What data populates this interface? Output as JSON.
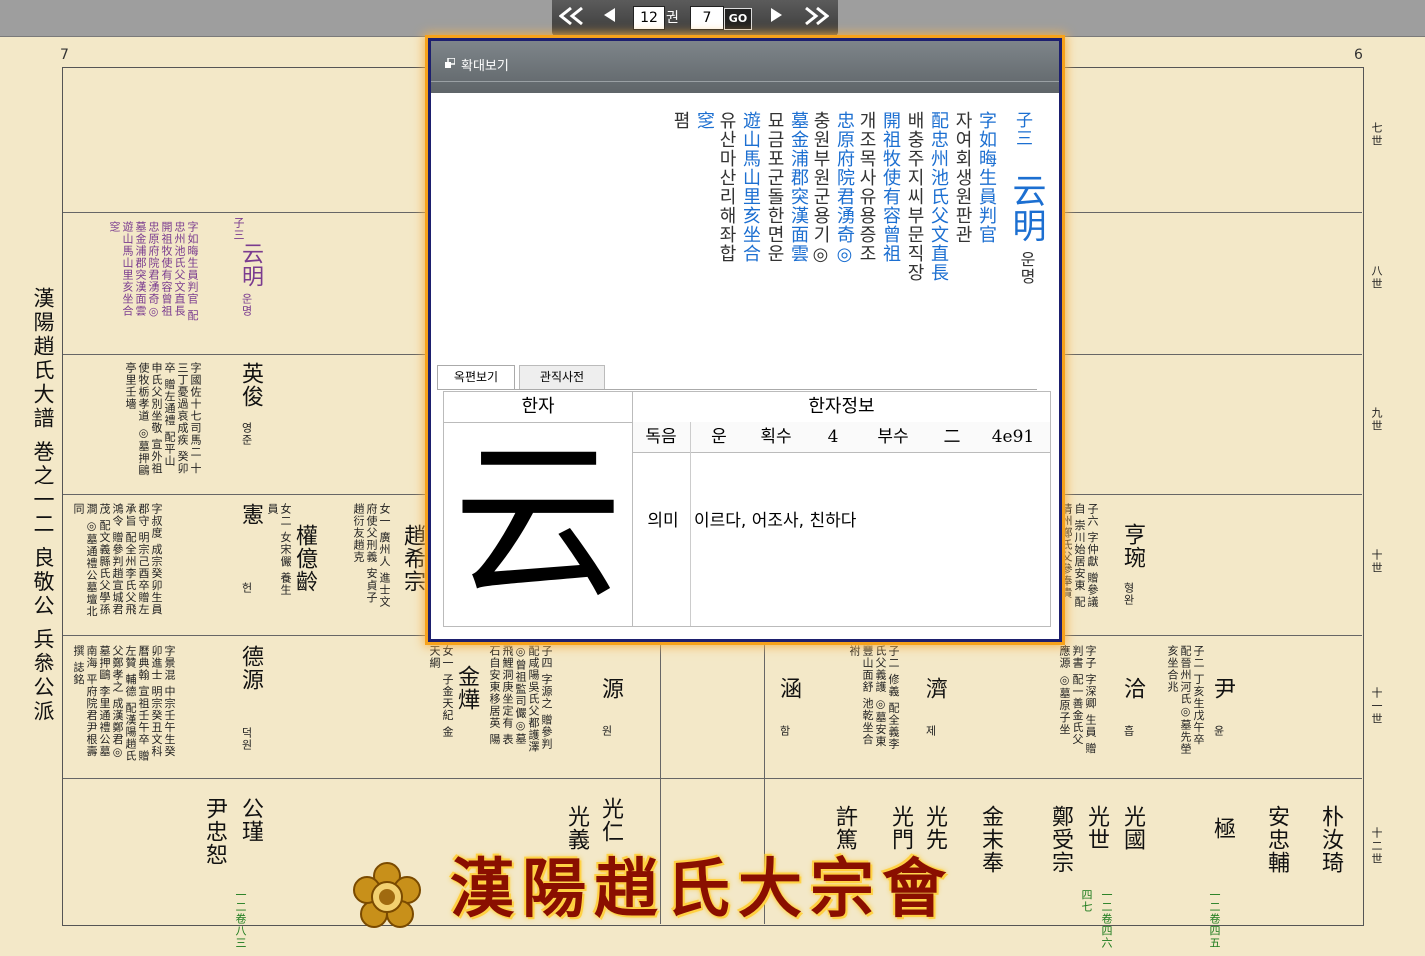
{
  "toolbar": {
    "first_icon": "double-left-arrow-icon",
    "prev_icon": "left-triangle-icon",
    "volume_value": "12",
    "volume_label": "권",
    "page_value": "7",
    "go_label": "GO",
    "next_icon": "right-triangle-icon",
    "last_icon": "double-right-arrow-icon"
  },
  "book": {
    "left_page_number": "7",
    "right_page_number": "6",
    "title": "漢陽趙氏大譜 巻之一二 良敬公 兵叅公派",
    "generations": [
      "七世",
      "八世",
      "九世",
      "十世",
      "十一世",
      "十二世"
    ]
  },
  "entries": {
    "yunmyeong_name": "云明",
    "yunmyeong_reading": "운명",
    "yunmyeong_rank": "子三",
    "yunmyeong_note": "字如晦生員判官 配忠州池氏父文直長 開祖牧使有容曾祖 忠原府院君湧奇◎ 墓金浦郡突漢面雲 遊山馬山里亥坐合 窆",
    "yeongjun_name": "英俊",
    "yeongjun_reading": "영준",
    "yeongjun_note": "字國佐十七司馬二 十三丁憂過哀成疾 癸卯卒 贈左通禮 配平山申氏父別坐敬 宣外祖使牧栃孝道 ◎墓押鷗亭里壬墻",
    "heon_name": "憲",
    "heon_reading": "헌",
    "heon_note": "字叔度 成宗癸卯生員郡守 明宗己酉卒贈左承旨 配全州李氏父飛鴻令 贈參判趙宣城君茂 配文義縣氏父學孫澗 ◎墓通禮公墓壇北 同",
    "gwon_name": "權億齡",
    "gwon_note": "女二 女宋儼 養生員",
    "jo_name": "趙希宗",
    "jo_note": "女一 廣州人 進士文府使父刑義 安貞子趙衍友趙克",
    "deokwon_name": "德源",
    "deokwon_reading": "덕원",
    "deokwon_note": "字景混 中宗壬午生癸卯進士 明宗癸丑文科曆典翰 宣祖壬午卒 贈左贊 輔德 配漢陽趙氏父鄭孝之 成漢鄭君◎墓押鷗 李里通禮公墓南海 平府院君尹根壽撰 誌銘",
    "kim_name": "金燁",
    "kim_note": "女一 子金天紀 金天綱",
    "won_name": "源",
    "won_reading": "원",
    "won_note": "子四 字源之 贈參判 配咸陽吳氏父都護澤 ◎曾祖監司儼◎墓 飛鯉洞庚坐定有 表石自安東移居英 陽",
    "ham_name": "涵",
    "ham_reading": "함",
    "je_name": "濟",
    "je_reading": "제",
    "je_note": "子二 修義 配全義李氏父義護 ◎墓安東豐山面舒 池乾坐合祔",
    "hak_name": "洽",
    "hak_reading": "흡",
    "hak_note": "字子 字深卿 生員 贈判書 配一善金氏父應源 ◎墓原子坐",
    "yun_name": "尹",
    "yun_reading": "윤",
    "yun_note": "子二 丁亥生戊午卒 配晉州河氏◎墓先塋 亥坐合兆",
    "hyeongwan_name": "亨琬",
    "hyeongwan_reading": "형완",
    "hyeongwan_note": "子六 字仲獻 贈參議自 崇川始居安東 配清州鄭氏父參奉貴",
    "gongjin_name": "公瑾",
    "yunchung_name": "尹忠恕",
    "gwangin_name": "光仁",
    "gwangui_name": "光義",
    "heo_name": "許篤",
    "gwangmun_name": "光門",
    "gwangseon_name": "光先",
    "kimmal_name": "金末奉",
    "jeong_name": "鄭受宗",
    "gwangse_name": "光世",
    "gwangguk_name": "光國",
    "geuk_name": "極",
    "anchung_name": "安忠輔",
    "park_name": "朴汝琦",
    "vol_tags": [
      "一二卷八三",
      "一二卷四六",
      "四七",
      "一二卷四五"
    ]
  },
  "popup": {
    "title": "확대보기",
    "window_icon": "restore-window-icon",
    "main_char": "云明",
    "main_reading": "운명",
    "rank": "子三",
    "lines": [
      {
        "hanja": "字如晦生員判官",
        "hangul": "자여회생원판관"
      },
      {
        "hanja": "配忠州池氏父文直長",
        "hangul": "배충주지씨부문직장"
      },
      {
        "hanja": "開祖牧使有容曾祖",
        "hangul": "개조목사유용증조"
      },
      {
        "hanja": "忠原府院君湧奇◎",
        "hangul": "충원부원군용기◎"
      },
      {
        "hanja": "墓金浦郡突漢面雲",
        "hangul": "묘금포군돌한면운"
      },
      {
        "hanja": "遊山馬山里亥坐合",
        "hangul": "유산마산리해좌합"
      },
      {
        "hanja": "窆",
        "hangul": "폄"
      }
    ],
    "tabs": [
      {
        "label": "옥편보기",
        "active": true
      },
      {
        "label": "관직사전",
        "active": false
      }
    ],
    "table": {
      "col_hanja": "한자",
      "col_info": "한자정보",
      "char": "云",
      "reading_label": "독음",
      "reading": "운",
      "strokes_label": "획수",
      "strokes": "4",
      "radical_label": "부수",
      "radical": "二",
      "code": "4e91",
      "meaning_label": "의미",
      "meaning": "이르다, 어조사, 친하다"
    }
  },
  "footer": {
    "logo_text": "漢陽趙氏大宗會",
    "logo_icon": "flower-seal-icon"
  }
}
